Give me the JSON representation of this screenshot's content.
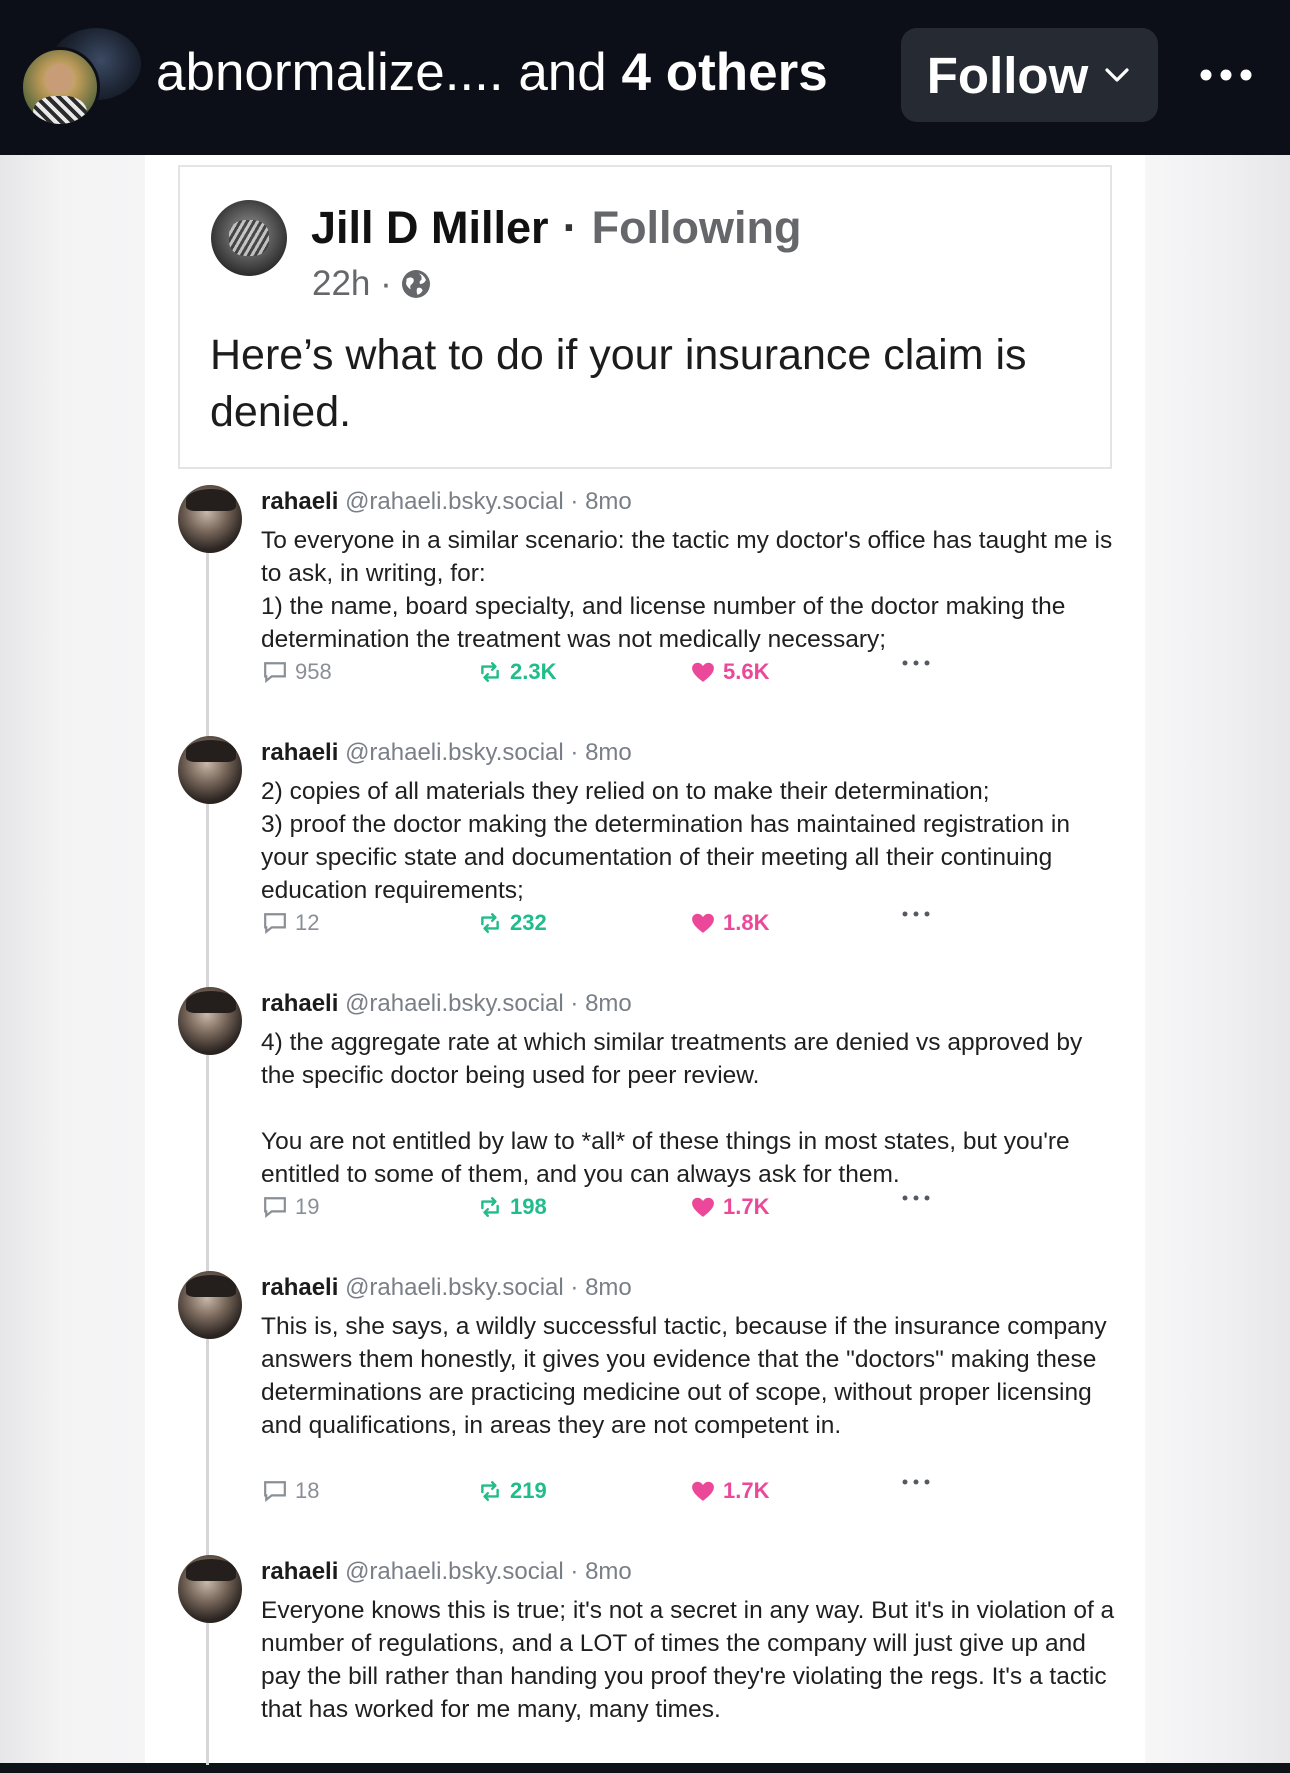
{
  "header": {
    "authors_prefix": "abnormalize....",
    "authors_connector": " and ",
    "authors_suffix": "4 others",
    "follow_label": "Follow"
  },
  "facebook_post": {
    "author": "Jill D Miller",
    "separator": "·",
    "follow_status": "Following",
    "time": "22h ·",
    "text": "Here’s what to do if your insurance claim is denied."
  },
  "thread": [
    {
      "author": "rahaeli",
      "handle": "@rahaeli.bsky.social · 8mo",
      "paragraphs": [
        "To everyone in a similar scenario: the tactic my doctor's office has taught me is to ask, in writing, for:\n1) the name, board specialty, and license number of the doctor making the determination the treatment was not medically necessary;"
      ],
      "replies": "958",
      "reposts": "2.3K",
      "likes": "5.6K"
    },
    {
      "author": "rahaeli",
      "handle": "@rahaeli.bsky.social · 8mo",
      "paragraphs": [
        "2) copies of all materials they relied on to make their determination;\n3) proof the doctor making the determination has maintained registration in your specific state and documentation of their meeting all their continuing education requirements;"
      ],
      "replies": "12",
      "reposts": "232",
      "likes": "1.8K"
    },
    {
      "author": "rahaeli",
      "handle": "@rahaeli.bsky.social · 8mo",
      "paragraphs": [
        "4) the aggregate rate at which similar treatments are denied vs approved by the specific doctor being used for peer review.",
        "You are not entitled by law to *all* of these things in most states, but you're entitled to some of them, and you can always ask for them."
      ],
      "replies": "19",
      "reposts": "198",
      "likes": "1.7K"
    },
    {
      "author": "rahaeli",
      "handle": "@rahaeli.bsky.social · 8mo",
      "paragraphs": [
        "This is, she says, a wildly successful tactic, because if the insurance company answers them honestly, it gives you evidence that the \"doctors\" making these determinations are practicing medicine out of scope, without proper licensing and qualifications, in areas they are not competent in."
      ],
      "replies": "18",
      "reposts": "219",
      "likes": "1.7K"
    },
    {
      "author": "rahaeli",
      "handle": "@rahaeli.bsky.social · 8mo",
      "paragraphs": [
        "Everyone knows this is true; it's not a secret in any way. But it's in violation of a number of regulations, and a LOT of times the company will just give up and pay the bill rather than handing you proof they're violating the regs. It's a tactic that has worked for me many, many times."
      ]
    }
  ]
}
